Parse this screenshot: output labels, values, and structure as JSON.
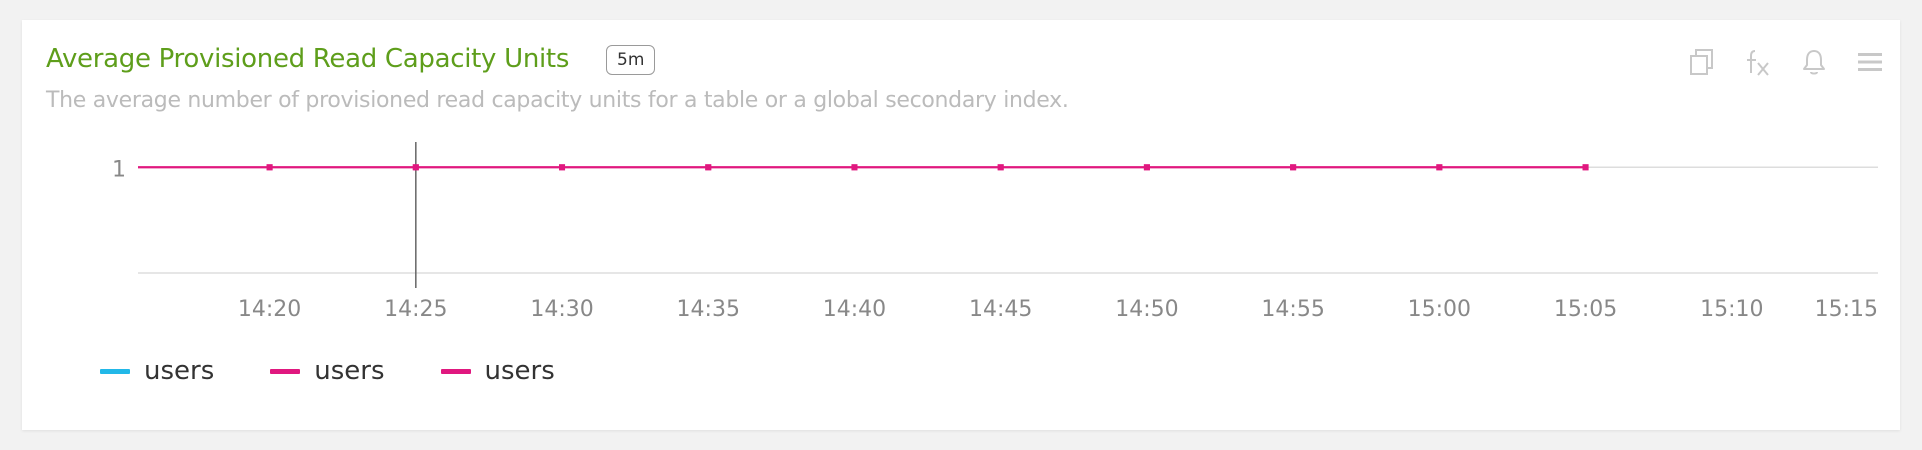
{
  "header": {
    "title": "Average Provisioned Read Capacity Units",
    "interval": "5m",
    "subtitle": "The average number of provisioned read capacity units for a table or a global secondary index."
  },
  "toolbar": {
    "icons": [
      "copy-icon",
      "function-icon",
      "bell-icon",
      "menu-icon"
    ],
    "icon_color": "#c8c8c8"
  },
  "colors": {
    "title": "#5e9e1b",
    "cyan": "#22b8e8",
    "magenta": "#e0187f",
    "grid": "#dddddd",
    "tick_text": "#888888"
  },
  "chart_data": {
    "type": "line",
    "title": "Average Provisioned Read Capacity Units",
    "xlabel": "",
    "ylabel": "",
    "x_ticks": [
      "14:20",
      "14:25",
      "14:30",
      "14:35",
      "14:40",
      "14:45",
      "14:50",
      "14:55",
      "15:00",
      "15:05",
      "15:10",
      "15:15"
    ],
    "y_ticks": [
      1
    ],
    "xlim": [
      "14:15.5",
      "15:15"
    ],
    "ylim": [
      0,
      1.4
    ],
    "grid": true,
    "cursor_x": "14:25",
    "legend_position": "bottom-left",
    "series": [
      {
        "name": "users",
        "color": "#22b8e8",
        "x": [],
        "y": []
      },
      {
        "name": "users",
        "color": "#e0187f",
        "x": [
          "14:15.5",
          "14:20",
          "14:25",
          "14:30",
          "14:35",
          "14:40",
          "14:45",
          "14:50",
          "14:55",
          "15:00",
          "15:05"
        ],
        "y": [
          1,
          1,
          1,
          1,
          1,
          1,
          1,
          1,
          1,
          1,
          1
        ]
      },
      {
        "name": "users",
        "color": "#e0187f",
        "x": [
          "14:15.5",
          "14:20",
          "14:25",
          "14:30",
          "14:35",
          "14:40",
          "14:45",
          "14:50",
          "14:55",
          "15:00",
          "15:05"
        ],
        "y": [
          1,
          1,
          1,
          1,
          1,
          1,
          1,
          1,
          1,
          1,
          1
        ]
      }
    ]
  }
}
